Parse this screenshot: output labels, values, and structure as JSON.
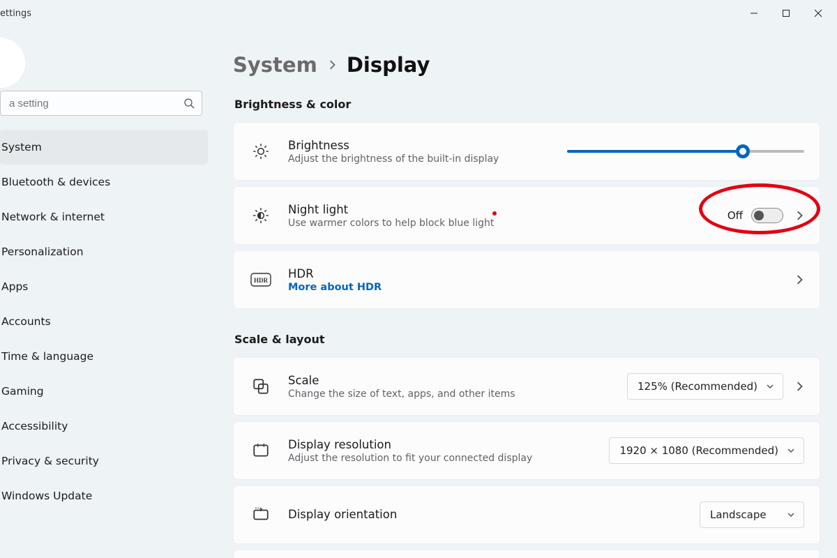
{
  "window": {
    "title": "ettings"
  },
  "search": {
    "placeholder": "a setting"
  },
  "sidebar": {
    "items": [
      {
        "label": "System"
      },
      {
        "label": "Bluetooth & devices"
      },
      {
        "label": "Network & internet"
      },
      {
        "label": "Personalization"
      },
      {
        "label": "Apps"
      },
      {
        "label": "Accounts"
      },
      {
        "label": "Time & language"
      },
      {
        "label": "Gaming"
      },
      {
        "label": "Accessibility"
      },
      {
        "label": "Privacy & security"
      },
      {
        "label": "Windows Update"
      }
    ]
  },
  "breadcrumb": {
    "parent": "System",
    "current": "Display"
  },
  "sections": {
    "brightness_color": "Brightness & color",
    "scale_layout": "Scale & layout"
  },
  "settings": {
    "brightness": {
      "title": "Brightness",
      "sub": "Adjust the brightness of the built-in display",
      "value_percent": 74
    },
    "night_light": {
      "title": "Night light",
      "sub": "Use warmer colors to help block blue light",
      "state_label": "Off"
    },
    "hdr": {
      "title": "HDR",
      "link": "More about HDR",
      "badge": "HDR"
    },
    "scale": {
      "title": "Scale",
      "sub": "Change the size of text, apps, and other items",
      "value": "125% (Recommended)"
    },
    "resolution": {
      "title": "Display resolution",
      "sub": "Adjust the resolution to fit your connected display",
      "value": "1920 × 1080 (Recommended)"
    },
    "orientation": {
      "title": "Display orientation",
      "value": "Landscape"
    }
  }
}
